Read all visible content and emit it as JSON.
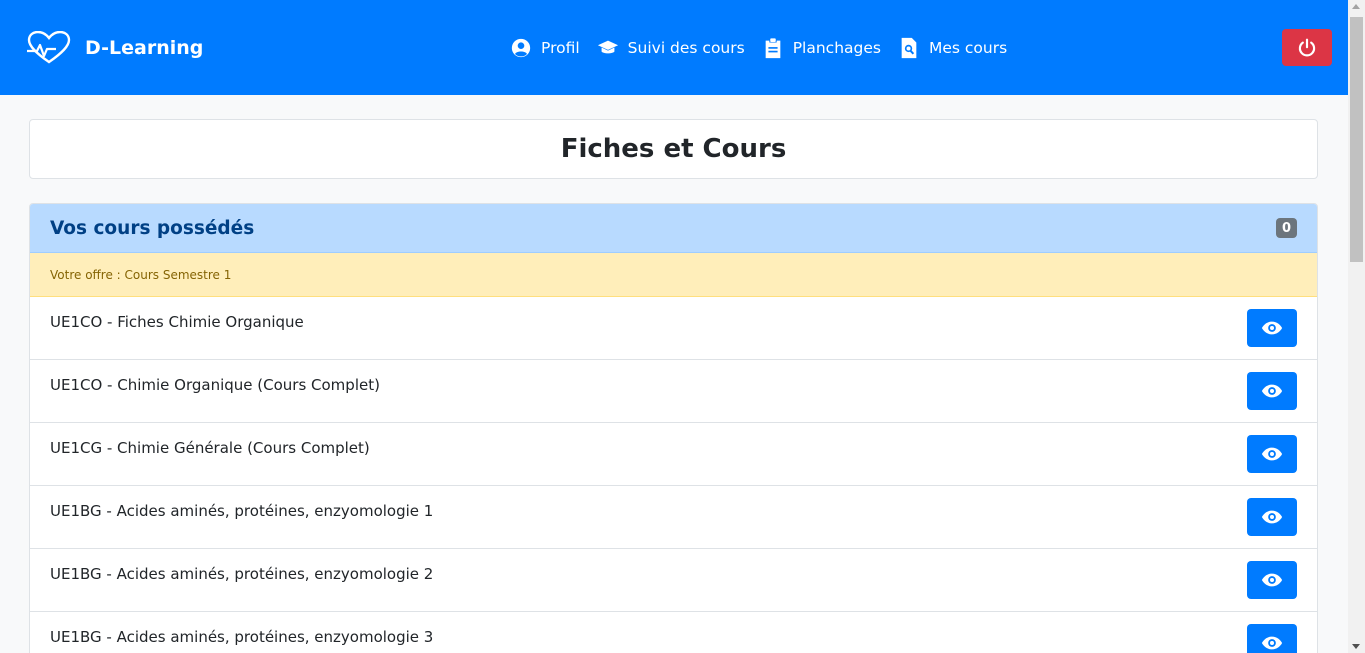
{
  "navbar": {
    "brand": "D-Learning",
    "links": [
      {
        "label": "Profil",
        "icon": "user-circle-icon"
      },
      {
        "label": "Suivi des cours",
        "icon": "graduation-cap-icon"
      },
      {
        "label": "Planchages",
        "icon": "clipboard-icon"
      },
      {
        "label": "Mes cours",
        "icon": "file-search-icon"
      }
    ],
    "logout_icon": "power-icon",
    "colors": {
      "background": "#007bff",
      "logout": "#dc3545"
    }
  },
  "page": {
    "title": "Fiches et Cours"
  },
  "courses": {
    "header": "Vos cours possédés",
    "count": "0",
    "offer": "Votre offre : Cours Semestre 1",
    "items": [
      {
        "title": "UE1CO - Fiches Chimie Organique"
      },
      {
        "title": "UE1CO - Chimie Organique (Cours Complet)"
      },
      {
        "title": "UE1CG - Chimie Générale (Cours Complet)"
      },
      {
        "title": "UE1BG - Acides aminés, protéines, enzyomologie 1"
      },
      {
        "title": "UE1BG - Acides aminés, protéines, enzyomologie 2"
      },
      {
        "title": "UE1BG - Acides aminés, protéines, enzyomologie 3"
      }
    ],
    "view_icon": "eye-icon"
  }
}
